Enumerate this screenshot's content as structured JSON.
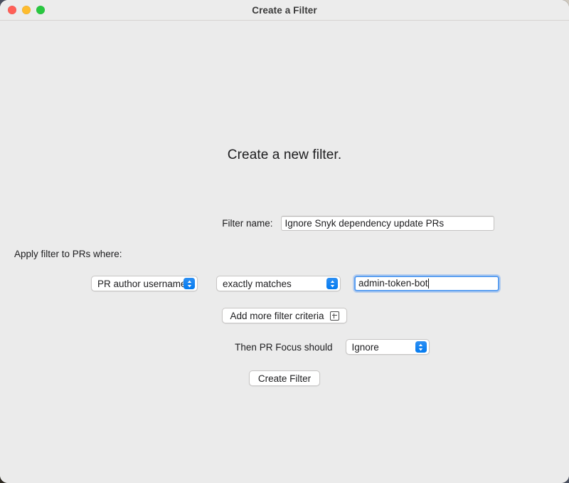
{
  "window": {
    "title": "Create a Filter",
    "traffic_lights": [
      {
        "name": "close",
        "color": "#ff5f57"
      },
      {
        "name": "minimize",
        "color": "#febc2e"
      },
      {
        "name": "maximize",
        "color": "#28c840"
      }
    ]
  },
  "main": {
    "heading": "Create a new filter.",
    "filter_name": {
      "label": "Filter name:",
      "value": "Ignore Snyk dependency update PRs",
      "placeholder": ""
    },
    "apply_label": "Apply filter to PRs where:",
    "criteria": {
      "field_select": {
        "value": "PR author username",
        "options": [
          "PR author username"
        ]
      },
      "operator_select": {
        "value": "exactly matches",
        "options": [
          "exactly matches"
        ]
      },
      "value_input": {
        "value": "admin-token-bot",
        "placeholder": "",
        "focused": true
      }
    },
    "add_criteria_button": {
      "label": "Add more filter criteria",
      "icon": "plus-box-icon"
    },
    "action": {
      "label": "Then PR Focus should",
      "select": {
        "value": "Ignore",
        "options": [
          "Ignore"
        ]
      }
    },
    "create_button": "Create Filter"
  },
  "colors": {
    "accent": "#0a7cf0",
    "focus_ring": "#5a9ef0",
    "window_bg": "#ebebeb",
    "titlebar_bg": "#ececec",
    "text": "#1d1d1f"
  }
}
